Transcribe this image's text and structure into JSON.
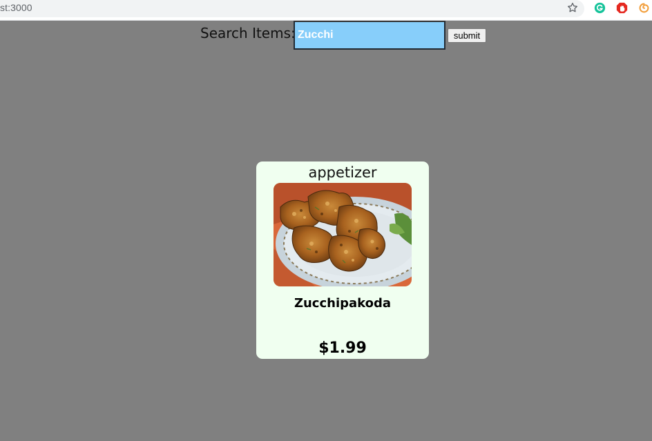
{
  "browser": {
    "url": "st:3000",
    "icons": {
      "bookmark": "star-icon",
      "extension_1": "grammarly-icon",
      "extension_2": "adblock-icon",
      "extension_3": "swirl-icon"
    }
  },
  "search": {
    "label": "Search Items:",
    "value": "Zucchi",
    "submit_label": "submit"
  },
  "results": [
    {
      "category": "appetizer",
      "name": "Zucchipakoda",
      "price": "$1.99",
      "image": "fried-pakoda-photo"
    }
  ],
  "colors": {
    "page_background": "#808080",
    "input_background": "#87cefa",
    "card_background": "#f0fff0"
  }
}
